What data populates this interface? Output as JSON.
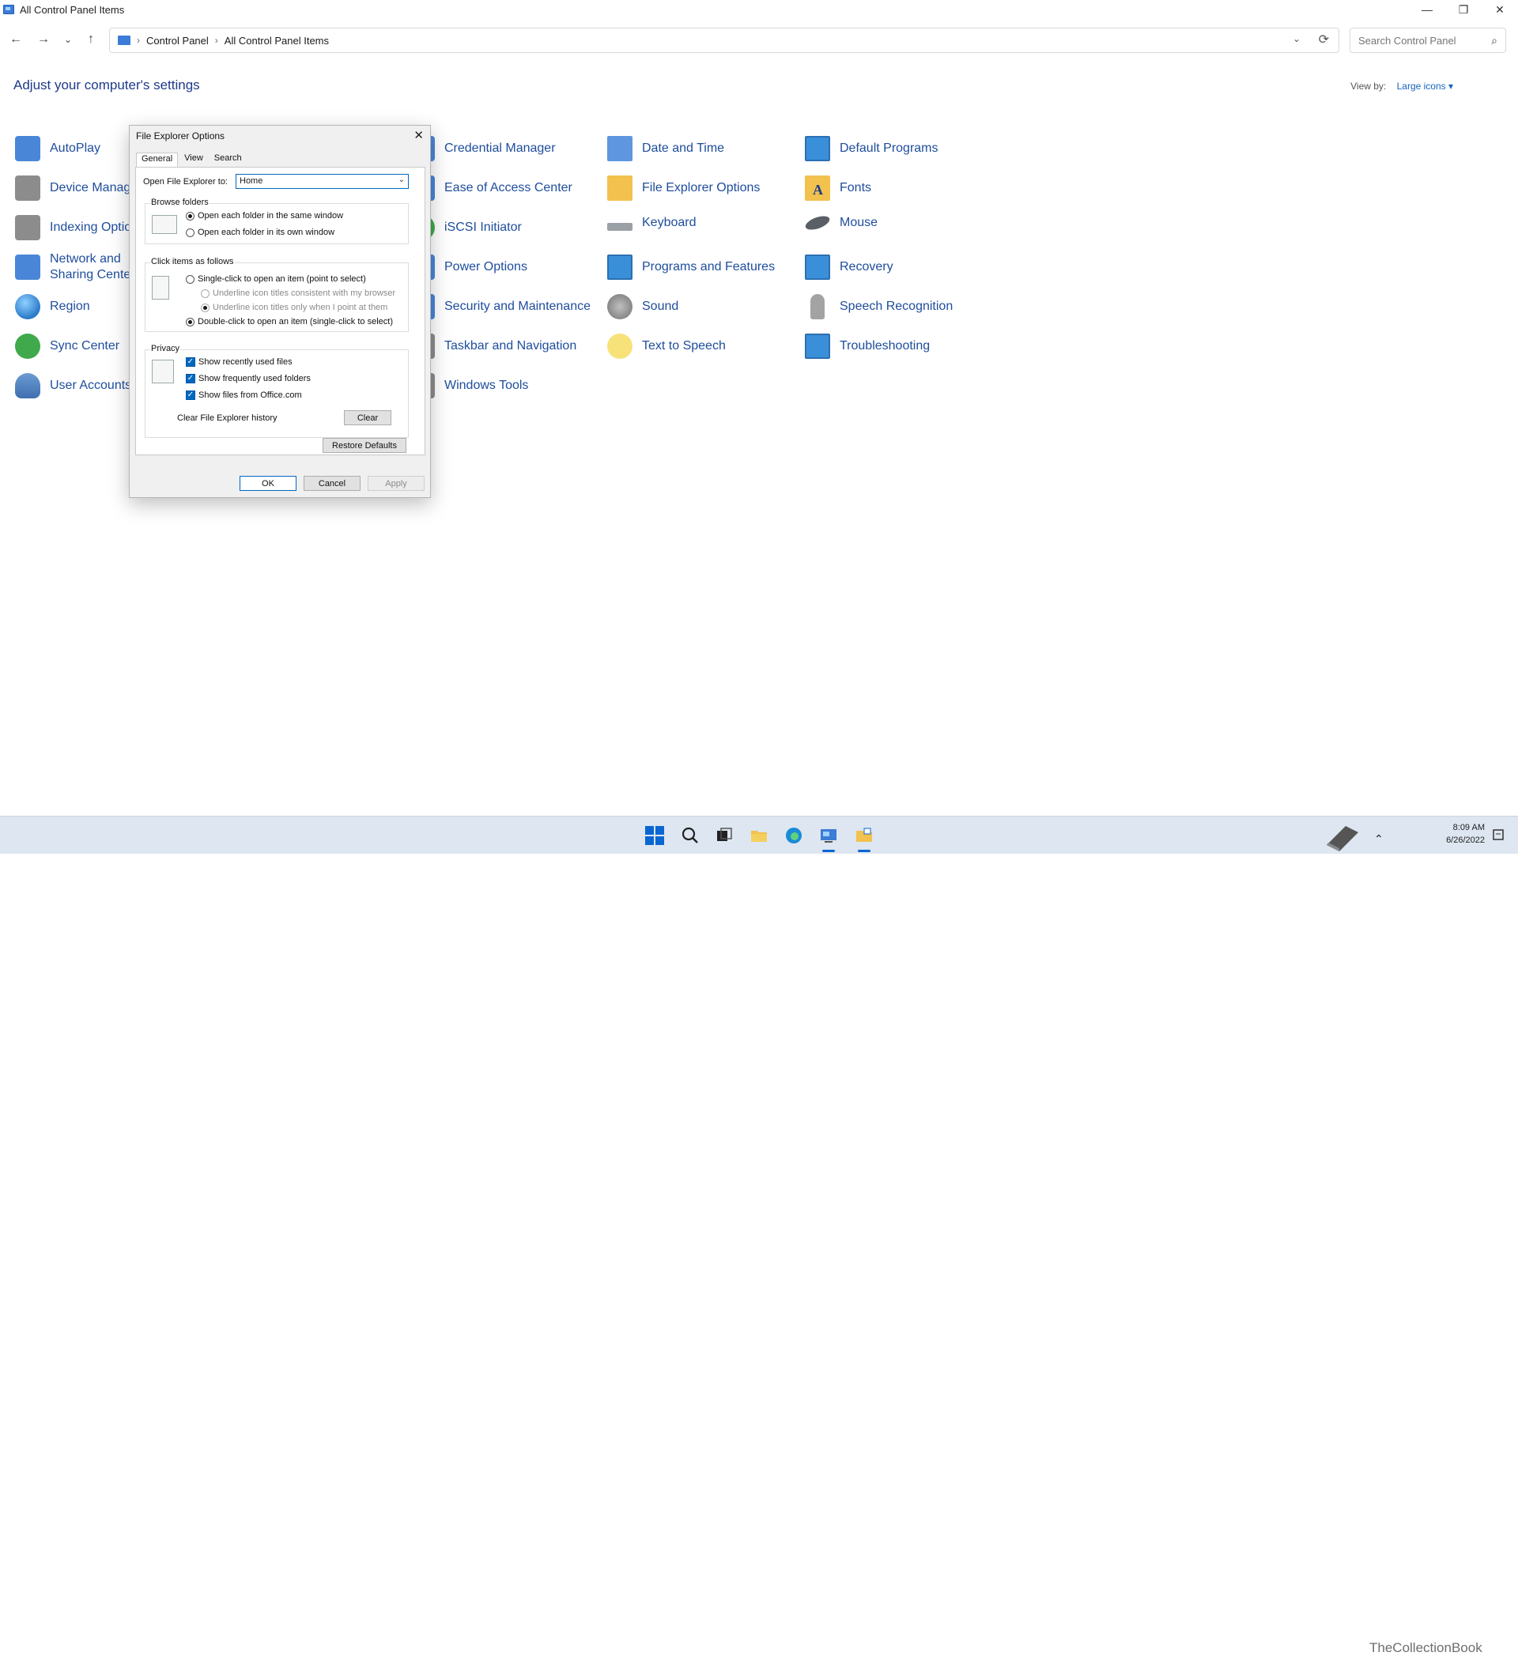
{
  "window": {
    "title": "All Control Panel Items",
    "minimize": "—",
    "restore": "❐",
    "close": "✕"
  },
  "nav": {
    "back": "←",
    "forward": "→",
    "recent": "⌄",
    "up": "↑",
    "breadcrumbs": [
      "Control Panel",
      "All Control Panel Items"
    ],
    "separator": "›",
    "dropdown": "⌄",
    "refresh": "⟳"
  },
  "search": {
    "placeholder": "Search Control Panel",
    "icon": "⌕"
  },
  "header": {
    "title": "Adjust your computer's settings",
    "view_by_label": "View by:",
    "view_by_value": "Large icons ▾"
  },
  "items": {
    "autoplay": "AutoPlay",
    "device_manager": "Device Manager",
    "indexing_options": "Indexing Options",
    "network_sharing": "Network and Sharing Center",
    "region": "Region",
    "sync_center": "Sync Center",
    "user_accounts": "User Accounts",
    "credential_manager": "Credential Manager",
    "ease_of_access": "Ease of Access Center",
    "iscsi": "iSCSI Initiator",
    "power_options": "Power Options",
    "security_maintenance": "Security and Maintenance",
    "taskbar_navigation": "Taskbar and Navigation",
    "windows_tools": "Windows Tools",
    "date_time": "Date and Time",
    "file_explorer_options": "File Explorer Options",
    "keyboard": "Keyboard",
    "programs_features": "Programs and Features",
    "sound": "Sound",
    "text_to_speech": "Text to Speech",
    "default_programs": "Default Programs",
    "fonts": "Fonts",
    "mouse": "Mouse",
    "recovery": "Recovery",
    "speech_recognition": "Speech Recognition",
    "troubleshooting": "Troubleshooting"
  },
  "dialog": {
    "title": "File Explorer Options",
    "close": "✕",
    "tabs": [
      "General",
      "View",
      "Search"
    ],
    "open_to_label": "Open File Explorer to:",
    "open_to_value": "Home",
    "open_to_dropdown": "⌄",
    "browse_group": "Browse folders",
    "browse_same": "Open each folder in the same window",
    "browse_own": "Open each folder in its own window",
    "click_group": "Click items as follows",
    "single_click": "Single-click to open an item (point to select)",
    "underline_browser": "Underline icon titles consistent with my browser",
    "underline_point": "Underline icon titles only when I point at them",
    "double_click": "Double-click to open an item (single-click to select)",
    "privacy_group": "Privacy",
    "check_mark": "✓",
    "recent_files": "Show recently used files",
    "frequent_folders": "Show frequently used folders",
    "office_files": "Show files from Office.com",
    "clear_history_label": "Clear File Explorer history",
    "clear_button": "Clear",
    "restore_defaults": "Restore Defaults",
    "ok": "OK",
    "cancel": "Cancel",
    "apply": "Apply"
  },
  "tray": {
    "time": "8:09 AM",
    "date": "6/26/2022",
    "chevron": "⌃"
  },
  "watermark": "TheCollectionBook",
  "colors": {
    "link_blue": "#1e4d9c",
    "title_blue": "#1e3a8a",
    "accent": "#0067c0",
    "taskbar": "#dde6f1"
  }
}
